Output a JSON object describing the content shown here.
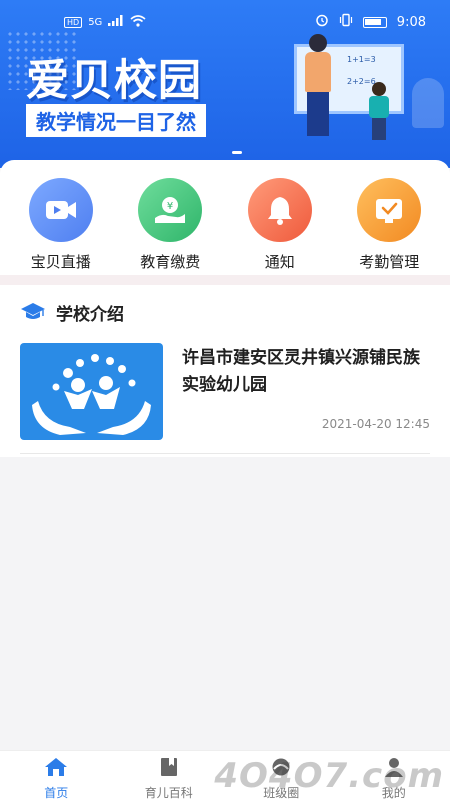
{
  "status_bar": {
    "hd": "HD",
    "network": "5G",
    "time": "9:08"
  },
  "banner": {
    "title": "爱贝校园",
    "subtitle": "教学情况一目了然",
    "board_formulas": [
      "1+1=3",
      "2+2=6"
    ]
  },
  "quick_menu": [
    {
      "label": "宝贝直播",
      "icon": "video-camera-icon",
      "color": "#5a8cf0"
    },
    {
      "label": "教育缴费",
      "icon": "money-hand-icon",
      "color": "#3dbd76"
    },
    {
      "label": "通知",
      "icon": "bell-icon",
      "color": "#f26a4f"
    },
    {
      "label": "考勤管理",
      "icon": "checklist-icon",
      "color": "#f29a2e"
    }
  ],
  "school_section": {
    "title": "学校介绍",
    "news": [
      {
        "title": "许昌市建安区灵井镇兴源铺民族实验幼儿园",
        "date": "2021-04-20 12:45"
      }
    ]
  },
  "tab_bar": {
    "tabs": [
      {
        "label": "首页",
        "icon": "home-icon",
        "active": true
      },
      {
        "label": "育儿百科",
        "icon": "book-icon",
        "active": false
      },
      {
        "label": "班级圈",
        "icon": "circle-icon",
        "active": false
      },
      {
        "label": "我的",
        "icon": "user-icon",
        "active": false
      }
    ]
  },
  "watermark": "4O4O7.com",
  "colors": {
    "primary": "#1e63e6",
    "active_tab": "#2b7ce8"
  }
}
